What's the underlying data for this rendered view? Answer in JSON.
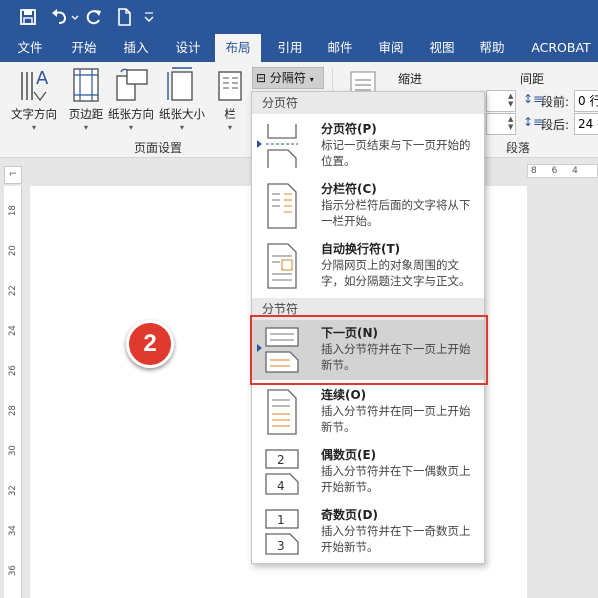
{
  "quick_access": {
    "save": "save-icon",
    "undo": "undo-icon",
    "redo": "redo-icon",
    "new": "new-document-icon",
    "customize": "chevron-down-icon"
  },
  "tabs": [
    "文件",
    "开始",
    "插入",
    "设计",
    "布局",
    "引用",
    "邮件",
    "审阅",
    "视图",
    "帮助",
    "ACROBAT"
  ],
  "active_tab": "布局",
  "ribbon": {
    "buttons": [
      "文字方向",
      "页边距",
      "纸张方向",
      "纸张大小",
      "栏"
    ],
    "breaks_button": "分隔符",
    "page_setup_group": "页面设置",
    "indent_label": "缩进",
    "spacing_label": "间距",
    "before_label": "段前:",
    "before_value": "0 行",
    "after_label": "段后:",
    "after_value": "24 行",
    "paragraph_group": "段落"
  },
  "ruler": {
    "top_numbers": "8 6 4",
    "left_numbers": [
      "18",
      "20",
      "22",
      "24",
      "26",
      "28",
      "30",
      "32",
      "34",
      "36"
    ]
  },
  "badge_number": "2",
  "menu": {
    "page_breaks_header": "分页符",
    "section_breaks_header": "分节符",
    "items": [
      {
        "title": "分页符(P)",
        "desc": "标记一页结束与下一页开始的位置。"
      },
      {
        "title": "分栏符(C)",
        "desc": "指示分栏符后面的文字将从下一栏开始。"
      },
      {
        "title": "自动换行符(T)",
        "desc": "分隔网页上的对象周围的文字，如分隔题注文字与正文。"
      },
      {
        "title": "下一页(N)",
        "desc": "插入分节符并在下一页上开始新节。"
      },
      {
        "title": "连续(O)",
        "desc": "插入分节符并在同一页上开始新节。"
      },
      {
        "title": "偶数页(E)",
        "desc": "插入分节符并在下一偶数页上开始新节。"
      },
      {
        "title": "奇数页(D)",
        "desc": "插入分节符并在下一奇数页上开始新节。"
      }
    ]
  },
  "colors": {
    "accent": "#2b579a",
    "highlight": "#d3d3d3",
    "callout": "#e03a2f"
  }
}
